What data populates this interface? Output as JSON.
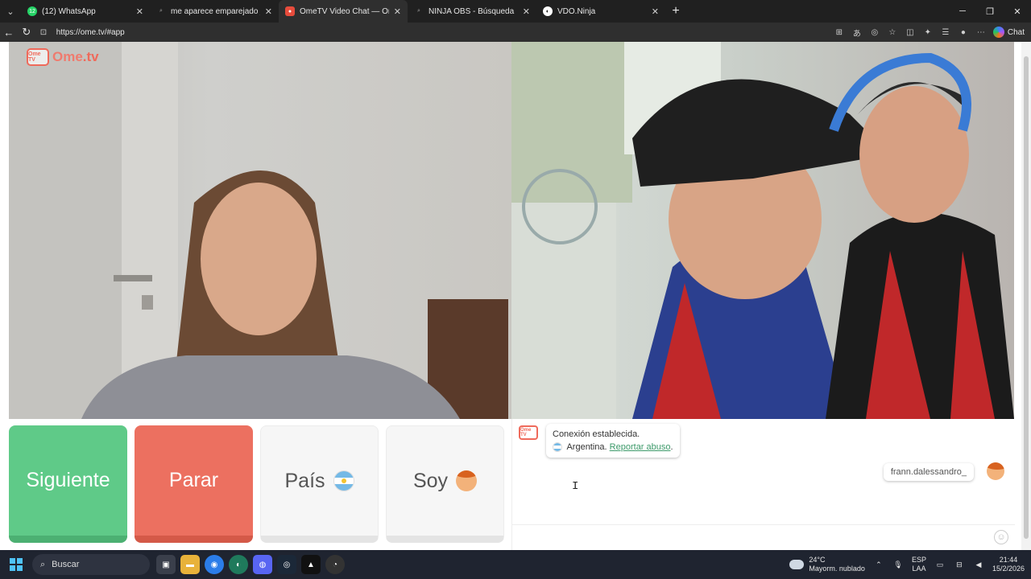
{
  "browser": {
    "tabs": [
      {
        "title": "(12) WhatsApp",
        "badge": "12",
        "favicon_color": "#25D366",
        "active": false
      },
      {
        "title": "me aparece emparejado joystick b",
        "favicon_color": "#444",
        "active": false
      },
      {
        "title": "OmeTV Video Chat — Omegl",
        "favicon_color": "#e74c3c",
        "active": true
      },
      {
        "title": "NINJA OBS - Búsqueda",
        "favicon_color": "#444",
        "active": false
      },
      {
        "title": "VDO.Ninja",
        "favicon_color": "#ffffff",
        "active": false
      }
    ],
    "url": "https://ome.tv/#app",
    "chat_label": "Chat"
  },
  "app": {
    "logo_text": "Ome",
    "logo_tld": ".tv",
    "logo_badge": "Ome TV",
    "buttons": {
      "next": "Siguiente",
      "stop": "Parar",
      "country": "País",
      "gender": "Soy"
    },
    "chat": {
      "system_line1": "Conexión establecida.",
      "country": "Argentina.",
      "report_link": "Reportar abuso",
      "report_suffix": ".",
      "username": "frann.dalessandro_",
      "input_value": ""
    }
  },
  "taskbar": {
    "search_placeholder": "Buscar",
    "weather_temp": "24°C",
    "weather_desc": "Mayorm. nublado",
    "lang_line1": "ESP",
    "lang_line2": "LAA",
    "time": "21:44",
    "date": "15/2/2026"
  },
  "colors": {
    "next": "#5fca88",
    "stop": "#ec7060",
    "brand": "#ef6a5b",
    "link": "#3d9a6a"
  }
}
